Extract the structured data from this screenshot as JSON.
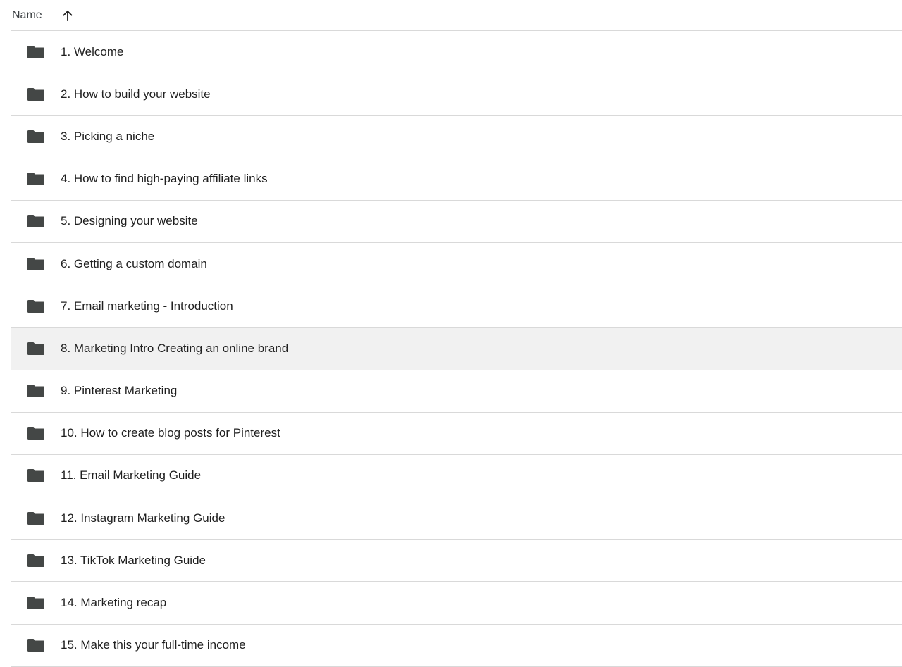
{
  "header": {
    "name_label": "Name",
    "sort_icon": "arrow-up-icon"
  },
  "folder_icon": "folder-icon",
  "colors": {
    "folder": "#444746",
    "divider": "#d9d9d9",
    "selected_row_bg": "#f1f1f1"
  },
  "rows": [
    {
      "label": "1. Welcome",
      "selected": false
    },
    {
      "label": "2. How to build your website",
      "selected": false
    },
    {
      "label": "3. Picking a niche",
      "selected": false
    },
    {
      "label": "4. How to find high-paying affiliate links",
      "selected": false
    },
    {
      "label": "5. Designing your website",
      "selected": false
    },
    {
      "label": "6. Getting a custom domain",
      "selected": false
    },
    {
      "label": "7. Email marketing - Introduction",
      "selected": false
    },
    {
      "label": "8. Marketing Intro Creating an online brand",
      "selected": true
    },
    {
      "label": "9. Pinterest Marketing",
      "selected": false
    },
    {
      "label": "10. How to create blog posts for Pinterest",
      "selected": false
    },
    {
      "label": "11. Email Marketing Guide",
      "selected": false
    },
    {
      "label": "12. Instagram Marketing Guide",
      "selected": false
    },
    {
      "label": "13. TikTok Marketing Guide",
      "selected": false
    },
    {
      "label": "14. Marketing recap",
      "selected": false
    },
    {
      "label": "15. Make this your full-time income",
      "selected": false
    }
  ]
}
